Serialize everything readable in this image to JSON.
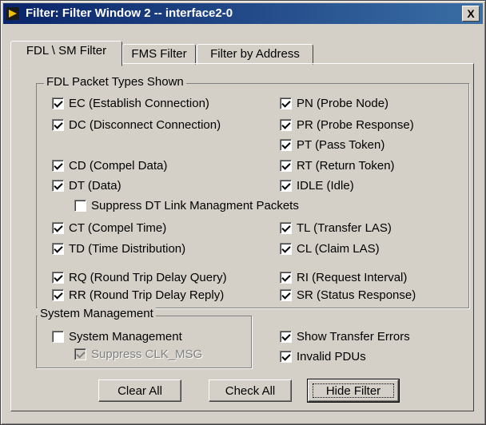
{
  "window": {
    "title": "Filter: Filter Window 2 -- interface2-0",
    "close_label": "X"
  },
  "tabs": [
    {
      "label": "FDL \\ SM Filter",
      "active": true
    },
    {
      "label": "FMS Filter",
      "active": false
    },
    {
      "label": "Filter by Address",
      "active": false
    }
  ],
  "fdl_group": {
    "legend": "FDL Packet Types Shown",
    "left": [
      {
        "label": "EC (Establish Connection)",
        "checked": true
      },
      {
        "label": "DC (Disconnect Connection)",
        "checked": true
      },
      {
        "label": "CD (Compel Data)",
        "checked": true
      },
      {
        "label": "DT (Data)",
        "checked": true
      },
      {
        "label": "Suppress DT Link Managment Packets",
        "checked": false
      },
      {
        "label": "CT (Compel Time)",
        "checked": true
      },
      {
        "label": "TD (Time Distribution)",
        "checked": true
      },
      {
        "label": "RQ (Round Trip Delay Query)",
        "checked": true
      },
      {
        "label": "RR (Round Trip Delay Reply)",
        "checked": true
      }
    ],
    "right": [
      {
        "label": "PN (Probe Node)",
        "checked": true
      },
      {
        "label": "PR (Probe Response)",
        "checked": true
      },
      {
        "label": "PT (Pass Token)",
        "checked": true
      },
      {
        "label": "RT (Return Token)",
        "checked": true
      },
      {
        "label": "IDLE (Idle)",
        "checked": true
      },
      {
        "label": "TL (Transfer LAS)",
        "checked": true
      },
      {
        "label": "CL (Claim LAS)",
        "checked": true
      },
      {
        "label": "RI (Request Interval)",
        "checked": true
      },
      {
        "label": "SR (Status Response)",
        "checked": true
      }
    ]
  },
  "sm_group": {
    "legend": "System Management",
    "system_management": {
      "label": "System Management",
      "checked": false
    },
    "suppress_clk": {
      "label": "Suppress CLK_MSG",
      "checked": true,
      "disabled": true
    }
  },
  "extra": {
    "show_transfer_errors": {
      "label": "Show Transfer Errors",
      "checked": true
    },
    "invalid_pdus": {
      "label": "Invalid PDUs",
      "checked": true
    }
  },
  "buttons": {
    "clear_all": "Clear All",
    "check_all": "Check All",
    "hide_filter": "Hide Filter"
  }
}
